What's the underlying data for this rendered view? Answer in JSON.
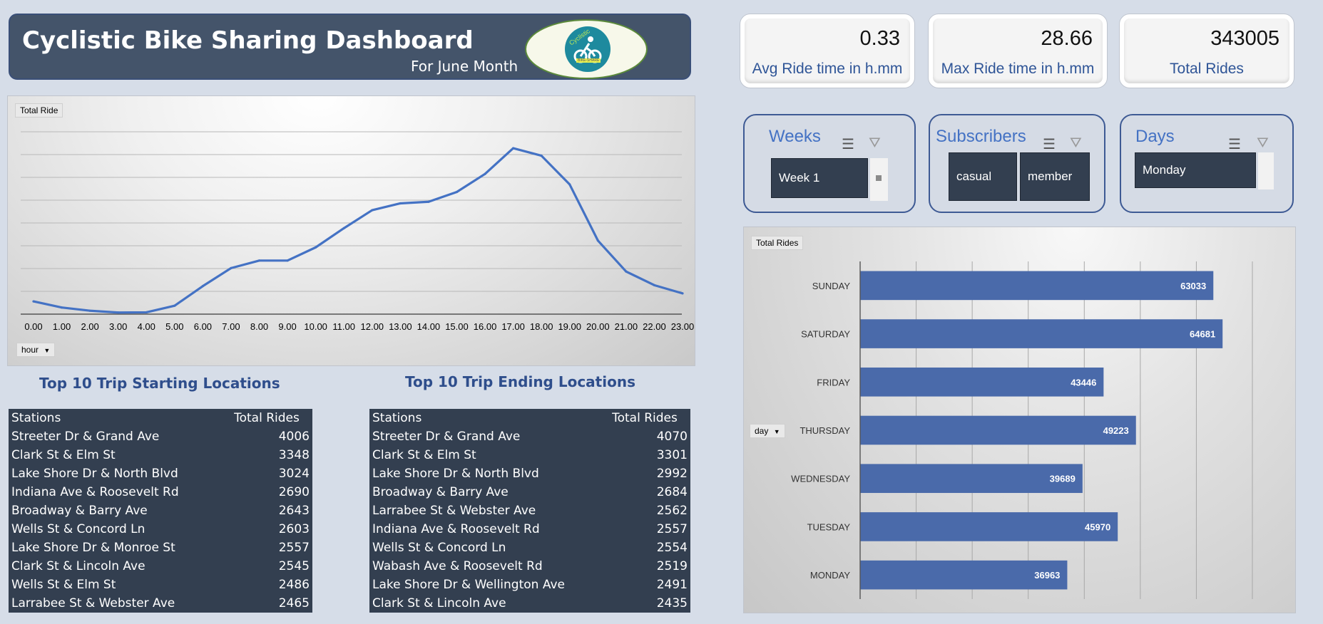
{
  "header": {
    "title": "Cyclistic Bike Sharing Dashboard",
    "subtitle": "For June Month",
    "logo_text": "Cyclistic",
    "logo_subtext": "BIKE-SHARE"
  },
  "kpis": [
    {
      "value": "0.33",
      "label": "Avg Ride time in h.mm"
    },
    {
      "value": "28.66",
      "label": "Max Ride time in h.mm"
    },
    {
      "value": "343005",
      "label": "Total Rides"
    }
  ],
  "slicers": {
    "weeks": {
      "title": "Weeks",
      "items": [
        "Week 1"
      ]
    },
    "subscribers": {
      "title": "Subscribers",
      "items": [
        "casual",
        "member"
      ]
    },
    "days": {
      "title": "Days",
      "items": [
        "Monday"
      ]
    }
  },
  "line_panel": {
    "value_button": "Total Ride",
    "axis_button": "hour"
  },
  "bar_panel": {
    "value_button": "Total Rides",
    "axis_button": "day"
  },
  "start_table": {
    "title": "Top 10 Trip Starting Locations",
    "headers": [
      "Stations",
      "Total Rides"
    ],
    "rows": [
      [
        "Streeter Dr & Grand Ave",
        "4006"
      ],
      [
        "Clark St & Elm St",
        "3348"
      ],
      [
        "Lake Shore Dr & North Blvd",
        "3024"
      ],
      [
        "Indiana Ave & Roosevelt Rd",
        "2690"
      ],
      [
        "Broadway & Barry Ave",
        "2643"
      ],
      [
        "Wells St & Concord Ln",
        "2603"
      ],
      [
        "Lake Shore Dr & Monroe St",
        "2557"
      ],
      [
        "Clark St & Lincoln Ave",
        "2545"
      ],
      [
        "Wells St & Elm St",
        "2486"
      ],
      [
        "Larrabee St & Webster Ave",
        "2465"
      ]
    ]
  },
  "end_table": {
    "title": "Top 10 Trip Ending Locations",
    "headers": [
      "Stations",
      "Total Rides"
    ],
    "rows": [
      [
        "Streeter Dr & Grand Ave",
        "4070"
      ],
      [
        "Clark St & Elm St",
        "3301"
      ],
      [
        "Lake Shore Dr & North Blvd",
        "2992"
      ],
      [
        "Broadway & Barry Ave",
        "2684"
      ],
      [
        "Larrabee St & Webster Ave",
        "2562"
      ],
      [
        "Indiana Ave & Roosevelt Rd",
        "2557"
      ],
      [
        "Wells St & Concord Ln",
        "2554"
      ],
      [
        "Wabash Ave & Roosevelt Rd",
        "2519"
      ],
      [
        "Lake Shore Dr & Wellington Ave",
        "2491"
      ],
      [
        "Clark St & Lincoln Ave",
        "2435"
      ]
    ]
  },
  "chart_data": [
    {
      "type": "line",
      "x": [
        "0.00",
        "1.00",
        "2.00",
        "3.00",
        "4.00",
        "5.00",
        "6.00",
        "7.00",
        "8.00",
        "9.00",
        "10.00",
        "11.00",
        "12.00",
        "13.00",
        "14.00",
        "15.00",
        "16.00",
        "17.00",
        "18.00",
        "19.00",
        "20.00",
        "21.00",
        "22.00",
        "23.00"
      ],
      "series": [
        {
          "values": [
            5600,
            2900,
            1500,
            700,
            800,
            3700,
            12300,
            20200,
            23500,
            23500,
            29300,
            37700,
            45600,
            48600,
            49300,
            53600,
            61500,
            72800,
            69500,
            56900,
            32300,
            18700,
            12700,
            9100
          ]
        }
      ],
      "ylim": [
        0,
        80000
      ],
      "grid": true,
      "color": "#4472c4"
    },
    {
      "type": "bar",
      "orientation": "horizontal",
      "categories": [
        "SUNDAY",
        "SATURDAY",
        "FRIDAY",
        "THURSDAY",
        "WEDNESDAY",
        "TUESDAY",
        "MONDAY"
      ],
      "values": [
        63033,
        64681,
        43446,
        49223,
        39689,
        45970,
        36963
      ],
      "xlim": [
        0,
        70000
      ],
      "grid": true,
      "data_labels": true,
      "color": "#4a6aaa"
    }
  ]
}
